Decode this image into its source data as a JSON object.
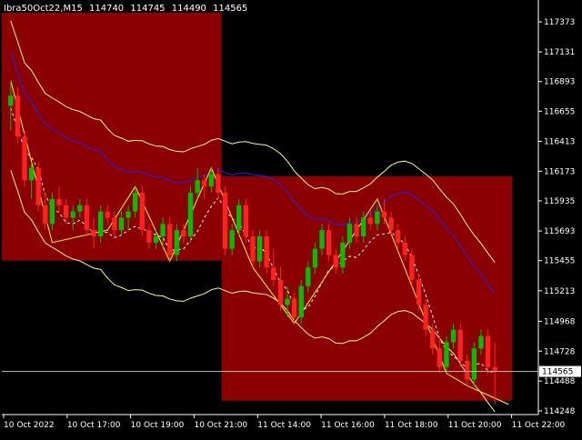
{
  "header": {
    "symbol": "Ibra50Oct22,M15",
    "open": "114740",
    "high": "114745",
    "low": "114490",
    "close": "114565"
  },
  "colors": {
    "background": "#000000",
    "box": "#8b0000",
    "bull": "#00c000",
    "bear": "#ff2020",
    "envelope": "#ffff66",
    "ma": "#2020ff",
    "zigzag": "#ffff00",
    "dashed": "#ffffff"
  },
  "chart_data": {
    "type": "candlestick",
    "price_axis": {
      "min": 114248,
      "max": 117373,
      "ticks": [
        "117373",
        "117131",
        "116893",
        "116655",
        "116413",
        "116173",
        "115935",
        "115693",
        "115455",
        "115213",
        "114968",
        "114728",
        "114488",
        "114248"
      ]
    },
    "time_axis": {
      "labels": [
        "10 Oct 2022",
        "10 Oct 17:00",
        "10 Oct 19:00",
        "10 Oct 21:00",
        "11 Oct 14:00",
        "11 Oct 16:00",
        "11 Oct 18:00",
        "11 Oct 20:00",
        "11 Oct 22:00"
      ]
    },
    "current_price": "114565",
    "boxes": [
      {
        "from_index": 0,
        "to_index": 30,
        "high": 117373,
        "low": 115455
      },
      {
        "from_index": 31,
        "to_index": 72,
        "high": 116060,
        "low": 114330
      }
    ],
    "candles": [
      [
        116700,
        116900,
        116500,
        116780
      ],
      [
        116780,
        116850,
        116400,
        116450
      ],
      [
        116450,
        116500,
        116050,
        116100
      ],
      [
        116100,
        116250,
        115950,
        116200
      ],
      [
        116200,
        116250,
        115850,
        115900
      ],
      [
        115900,
        116000,
        115700,
        115750
      ],
      [
        115750,
        116000,
        115700,
        115950
      ],
      [
        115950,
        116050,
        115850,
        115900
      ],
      [
        115900,
        115950,
        115750,
        115800
      ],
      [
        115800,
        115900,
        115700,
        115850
      ],
      [
        115850,
        115950,
        115800,
        115900
      ],
      [
        115900,
        115950,
        115650,
        115700
      ],
      [
        115700,
        115800,
        115550,
        115650
      ],
      [
        115650,
        115900,
        115600,
        115850
      ],
      [
        115850,
        115900,
        115750,
        115800
      ],
      [
        115800,
        115850,
        115650,
        115700
      ],
      [
        115700,
        115850,
        115650,
        115800
      ],
      [
        115800,
        115900,
        115700,
        115850
      ],
      [
        115850,
        116050,
        115800,
        116000
      ],
      [
        116000,
        116050,
        115650,
        115700
      ],
      [
        115700,
        115750,
        115550,
        115600
      ],
      [
        115600,
        115700,
        115550,
        115650
      ],
      [
        115650,
        115800,
        115550,
        115750
      ],
      [
        115750,
        115800,
        115450,
        115500
      ],
      [
        115500,
        115750,
        115450,
        115700
      ],
      [
        115700,
        115750,
        115600,
        115650
      ],
      [
        115650,
        116050,
        115600,
        116000
      ],
      [
        116000,
        116200,
        115950,
        116100
      ],
      [
        116100,
        116150,
        115950,
        116050
      ],
      [
        116050,
        116200,
        116000,
        116150
      ],
      [
        116150,
        116200,
        115950,
        116000
      ],
      [
        116000,
        116050,
        115500,
        115550
      ],
      [
        115550,
        115750,
        115500,
        115700
      ],
      [
        115700,
        115950,
        115650,
        115900
      ],
      [
        115900,
        115950,
        115600,
        115650
      ],
      [
        115650,
        115700,
        115400,
        115450
      ],
      [
        115450,
        115700,
        115400,
        115650
      ],
      [
        115650,
        115700,
        115350,
        115400
      ],
      [
        115400,
        115550,
        115250,
        115300
      ],
      [
        115300,
        115400,
        115050,
        115100
      ],
      [
        115100,
        115250,
        115000,
        115150
      ],
      [
        115150,
        115200,
        114950,
        115000
      ],
      [
        115000,
        115300,
        114950,
        115250
      ],
      [
        115250,
        115450,
        115200,
        115400
      ],
      [
        115400,
        115600,
        115350,
        115550
      ],
      [
        115550,
        115750,
        115500,
        115700
      ],
      [
        115700,
        115750,
        115450,
        115500
      ],
      [
        115500,
        115550,
        115350,
        115400
      ],
      [
        115400,
        115650,
        115350,
        115600
      ],
      [
        115600,
        115800,
        115550,
        115750
      ],
      [
        115750,
        115800,
        115600,
        115650
      ],
      [
        115650,
        115850,
        115600,
        115800
      ],
      [
        115800,
        115850,
        115700,
        115750
      ],
      [
        115750,
        115900,
        115700,
        115850
      ],
      [
        115850,
        115950,
        115750,
        115800
      ],
      [
        115800,
        115850,
        115650,
        115700
      ],
      [
        115700,
        115750,
        115550,
        115600
      ],
      [
        115600,
        115650,
        115450,
        115500
      ],
      [
        115500,
        115550,
        115250,
        115300
      ],
      [
        115300,
        115350,
        115050,
        115100
      ],
      [
        115100,
        115150,
        114850,
        114900
      ],
      [
        114900,
        114950,
        114700,
        114750
      ],
      [
        114750,
        114850,
        114550,
        114600
      ],
      [
        114600,
        114850,
        114550,
        114800
      ],
      [
        114800,
        114950,
        114750,
        114900
      ],
      [
        114900,
        114950,
        114600,
        114650
      ],
      [
        114650,
        114700,
        114450,
        114500
      ],
      [
        114500,
        114800,
        114450,
        114750
      ],
      [
        114750,
        114900,
        114700,
        114850
      ],
      [
        114850,
        114900,
        114550,
        114600
      ],
      [
        114600,
        114800,
        114300,
        114565
      ]
    ]
  }
}
